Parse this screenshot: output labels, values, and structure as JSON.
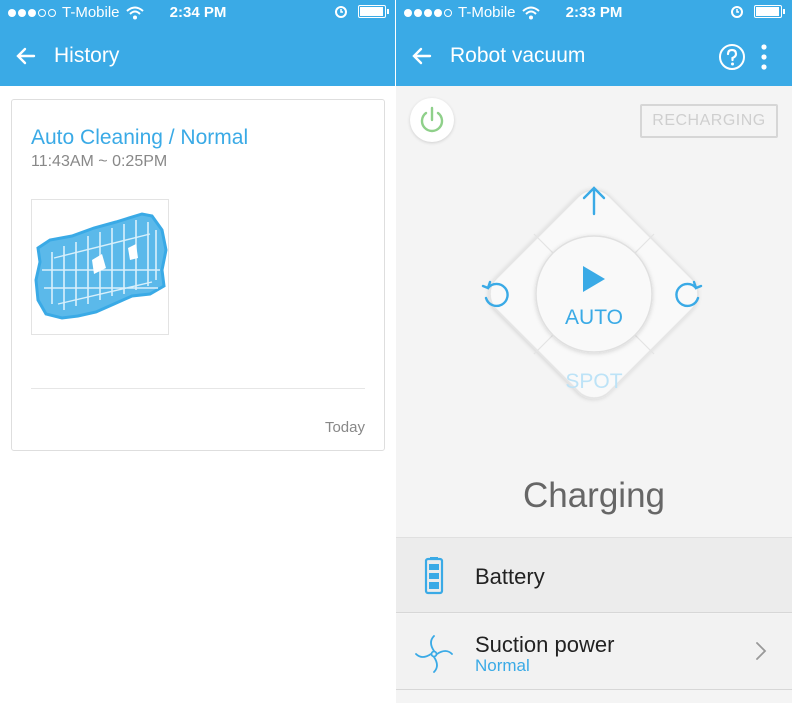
{
  "left_screen": {
    "status_bar": {
      "carrier": "T-Mobile",
      "time": "2:34 PM"
    },
    "app_bar": {
      "title": "History"
    },
    "history_card": {
      "title": "Auto Cleaning / Normal",
      "time_range": "11:43AM ~ 0:25PM",
      "date": "Today"
    }
  },
  "right_screen": {
    "status_bar": {
      "carrier": "T-Mobile",
      "time": "2:33 PM"
    },
    "app_bar": {
      "title": "Robot vacuum"
    },
    "status_chip": "RECHARGING",
    "dpad": {
      "center_label": "AUTO",
      "bottom_label": "SPOT"
    },
    "state_text": "Charging",
    "rows": {
      "battery": {
        "label": "Battery"
      },
      "suction": {
        "label": "Suction power",
        "value": "Normal"
      }
    }
  },
  "colors": {
    "accent": "#3aaae6",
    "power_icon": "#8fd08a",
    "disabled_text": "#cfcfcf"
  },
  "icons": [
    "back-arrow-icon",
    "help-icon",
    "more-vert-icon",
    "power-icon",
    "arrow-up-icon",
    "rotate-left-icon",
    "rotate-right-icon",
    "play-icon",
    "battery-icon",
    "fan-icon",
    "chevron-right-icon",
    "wifi-icon",
    "alarm-icon"
  ]
}
